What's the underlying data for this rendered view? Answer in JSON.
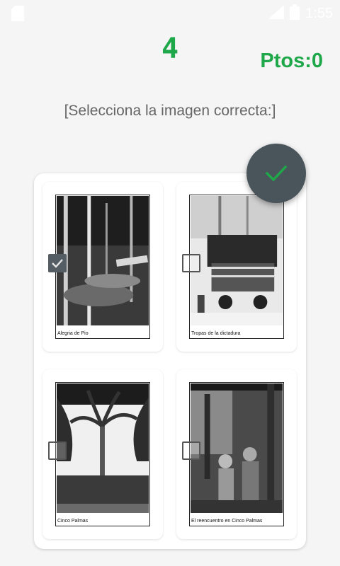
{
  "status_bar": {
    "time": "1:55"
  },
  "counter": "4",
  "score": "Ptos:0",
  "prompt": "[Selecciona la imagen correcta:]",
  "confirm_icon": "check-icon",
  "accent_color": "#1fa84a",
  "options": [
    {
      "caption": "Alegria de Pio",
      "checked": true
    },
    {
      "caption": "Tropas de la dictadura",
      "checked": false
    },
    {
      "caption": "Cinco Palmas",
      "checked": false
    },
    {
      "caption": "El reencuentro en Cinco Palmas",
      "checked": false
    }
  ]
}
